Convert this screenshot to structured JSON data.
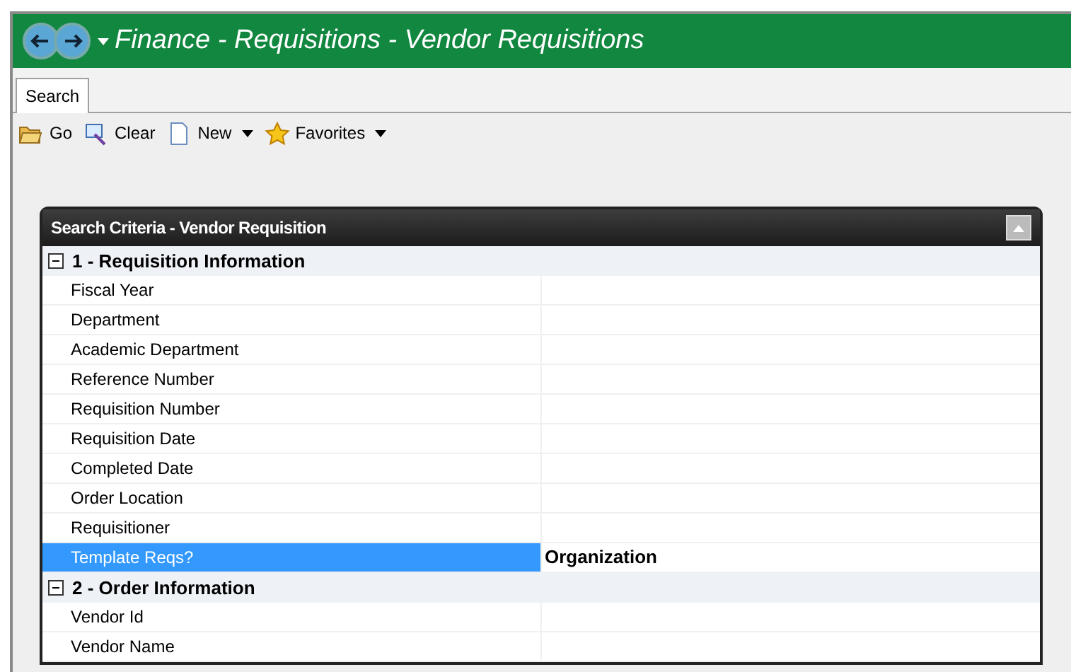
{
  "window": {
    "title": "Finance - Requisitions - Vendor Requisitions"
  },
  "tabs": [
    {
      "label": "Search",
      "selected": true
    }
  ],
  "toolbar": [
    {
      "kind": "go",
      "label": "Go",
      "dropdown": false
    },
    {
      "kind": "clear",
      "label": "Clear",
      "dropdown": false
    },
    {
      "kind": "new",
      "label": "New",
      "dropdown": true
    },
    {
      "kind": "favorites",
      "label": "Favorites",
      "dropdown": true
    }
  ],
  "panel": {
    "title": "Search Criteria - Vendor Requisition",
    "groups": [
      {
        "label": "1 - Requisition Information",
        "expanded": true,
        "rows": [
          {
            "label": "Fiscal Year",
            "selected": false
          },
          {
            "label": "Department",
            "selected": false
          },
          {
            "label": "Academic Department",
            "selected": false
          },
          {
            "label": "Reference Number",
            "selected": false
          },
          {
            "label": "Requisition Number",
            "selected": false
          },
          {
            "label": "Requisition Date",
            "selected": false
          },
          {
            "label": "Completed Date",
            "selected": false
          },
          {
            "label": "Order Location",
            "selected": false
          },
          {
            "label": "Requisitioner",
            "selected": false
          },
          {
            "label": "Template Reqs?",
            "selected": true,
            "value": "Organization"
          }
        ]
      },
      {
        "label": "2 - Order Information",
        "expanded": true,
        "rows": [
          {
            "label": "Vendor Id",
            "selected": false
          },
          {
            "label": "Vendor Name",
            "selected": false
          }
        ]
      }
    ]
  }
}
